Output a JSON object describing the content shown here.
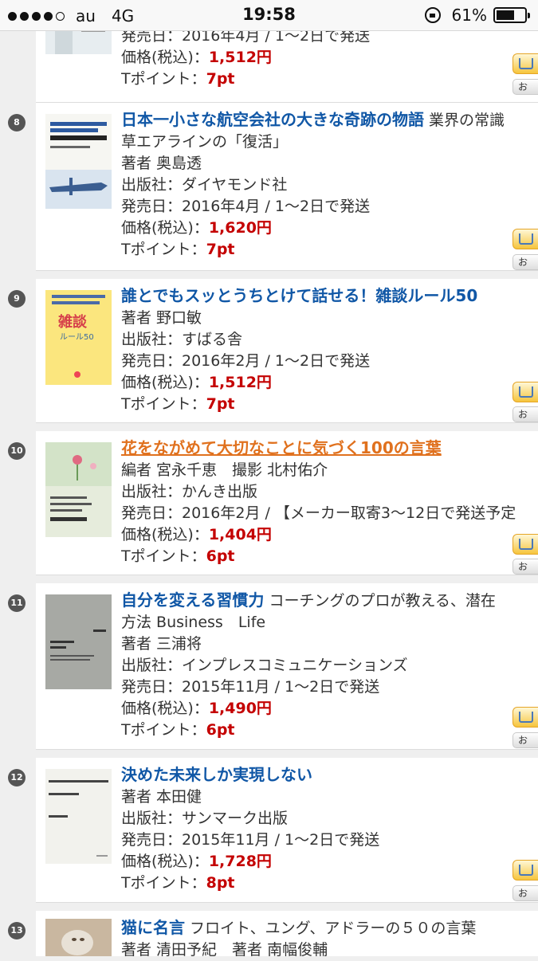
{
  "status_bar": {
    "carrier": "au",
    "network": "4G",
    "time": "19:58",
    "battery": "61%"
  },
  "items": [
    {
      "release": "発売日：2016年4月 / 1～2日で発送",
      "price_label": "価格(税込)：",
      "price": "1,512円",
      "point_label": "Tポイント：",
      "points": "7pt"
    },
    {
      "rank": "8",
      "title": "日本一小さな航空会社の大きな奇跡の物語",
      "subtitle_rest": " 業界の常識",
      "subtitle2": "草エアラインの「復活」",
      "author": "著者 奥島透",
      "publisher": "出版社：ダイヤモンド社",
      "release": "発売日：2016年4月 / 1～2日で発送",
      "price_label": "価格(税込)：",
      "price": "1,620円",
      "point_label": "Tポイント：",
      "points": "7pt",
      "cover": {
        "bg": "#f4f4f0",
        "text": "日本一小さな航空会社の大きな奇跡の物語"
      }
    },
    {
      "rank": "9",
      "title": "誰とでもスッとうちとけて話せる！雑談ルール50",
      "author": "著者 野口敏",
      "publisher": "出版社：すばる舎",
      "release": "発売日：2016年2月 / 1～2日で発送",
      "price_label": "価格(税込)：",
      "price": "1,512円",
      "point_label": "Tポイント：",
      "points": "7pt",
      "cover": {
        "bg": "#fbe98a",
        "text": "雑談 ルール50"
      }
    },
    {
      "rank": "10",
      "title": "花をながめて大切なことに気づく100の言葉",
      "author": "編者 宮永千恵　撮影 北村佑介",
      "publisher": "出版社：かんき出版",
      "release": "発売日：2016年2月 / 【メーカー取寄3～12日で発送予定",
      "price_label": "価格(税込)：",
      "price": "1,404円",
      "point_label": "Tポイント：",
      "points": "6pt",
      "cover": {
        "bg": "#dfe8d2",
        "text": "花をながめて大切なことに気づく100の言葉"
      }
    },
    {
      "rank": "11",
      "title": "自分を変える習慣力",
      "subtitle_rest": " コーチングのプロが教える、潜在",
      "subtitle2": "方法 Business　Life",
      "author": "著者 三浦将",
      "publisher": "出版社：インプレスコミュニケーションズ",
      "release": "発売日：2015年11月 / 1～2日で発送",
      "price_label": "価格(税込)：",
      "price": "1,490円",
      "point_label": "Tポイント：",
      "points": "6pt",
      "cover": {
        "bg": "#a9aba6",
        "text": "自分を変える習慣力"
      }
    },
    {
      "rank": "12",
      "title": "決めた未来しか実現しない",
      "author": "著者 本田健",
      "publisher": "出版社：サンマーク出版",
      "release": "発売日：2015年11月 / 1～2日で発送",
      "price_label": "価格(税込)：",
      "price": "1,728円",
      "point_label": "Tポイント：",
      "points": "8pt",
      "cover": {
        "bg": "#f2f2ee",
        "text": "決めた未来しか実現しない 本田 健"
      }
    },
    {
      "rank": "13",
      "title": "猫に名言",
      "subtitle_rest": " フロイト、ユング、アドラーの５０の言葉",
      "author": "著者 清田予紀　著者 南幅俊輔",
      "cover": {
        "bg": "#c8b8a4",
        "text": "猫に名言"
      }
    }
  ]
}
